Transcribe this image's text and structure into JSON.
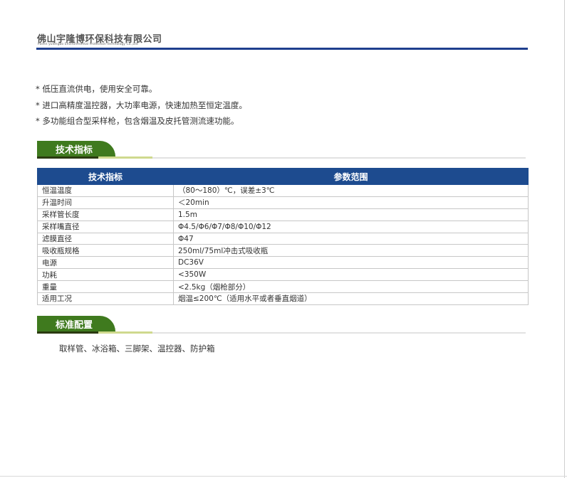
{
  "header": {
    "company_cn": "佛山宇隆博环保科技有限公司",
    "company_en": "Foshn yulongbo Environmental Protection Technology Co.,Ltd",
    "rule_color": "#1e3f8e"
  },
  "features": [
    "* 低压直流供电，使用安全可靠。",
    "* 进口高精度温控器，大功率电源，快速加热至恒定温度。",
    "* 多功能组合型采样枪，包含烟温及皮托管测流速功能。"
  ],
  "sections": {
    "specs_title": "技术指标",
    "config_title": "标准配置",
    "tab_color": "#3f7a1e"
  },
  "table": {
    "header_color": "#1d4b8f",
    "headers": [
      "技术指标",
      "参数范围"
    ],
    "rows": [
      [
        "恒温温度",
        "（80～180）℃，误差±3℃"
      ],
      [
        "升温时间",
        "＜20min"
      ],
      [
        "采样管长度",
        "1.5m"
      ],
      [
        "采样嘴直径",
        "Φ4.5/Φ6/Φ7/Φ8/Φ10/Φ12"
      ],
      [
        "滤膜直径",
        "Φ47"
      ],
      [
        "吸收瓶规格",
        "250ml/75ml冲击式吸收瓶"
      ],
      [
        "电源",
        "DC36V"
      ],
      [
        "功耗",
        "<350W"
      ],
      [
        "重量",
        "<2.5kg（烟枪部分）"
      ],
      [
        "适用工况",
        "烟温≤200℃（适用水平或者垂直烟道）"
      ]
    ]
  },
  "config": {
    "items": "取样管、冰浴箱、三脚架、温控器、防护箱"
  }
}
